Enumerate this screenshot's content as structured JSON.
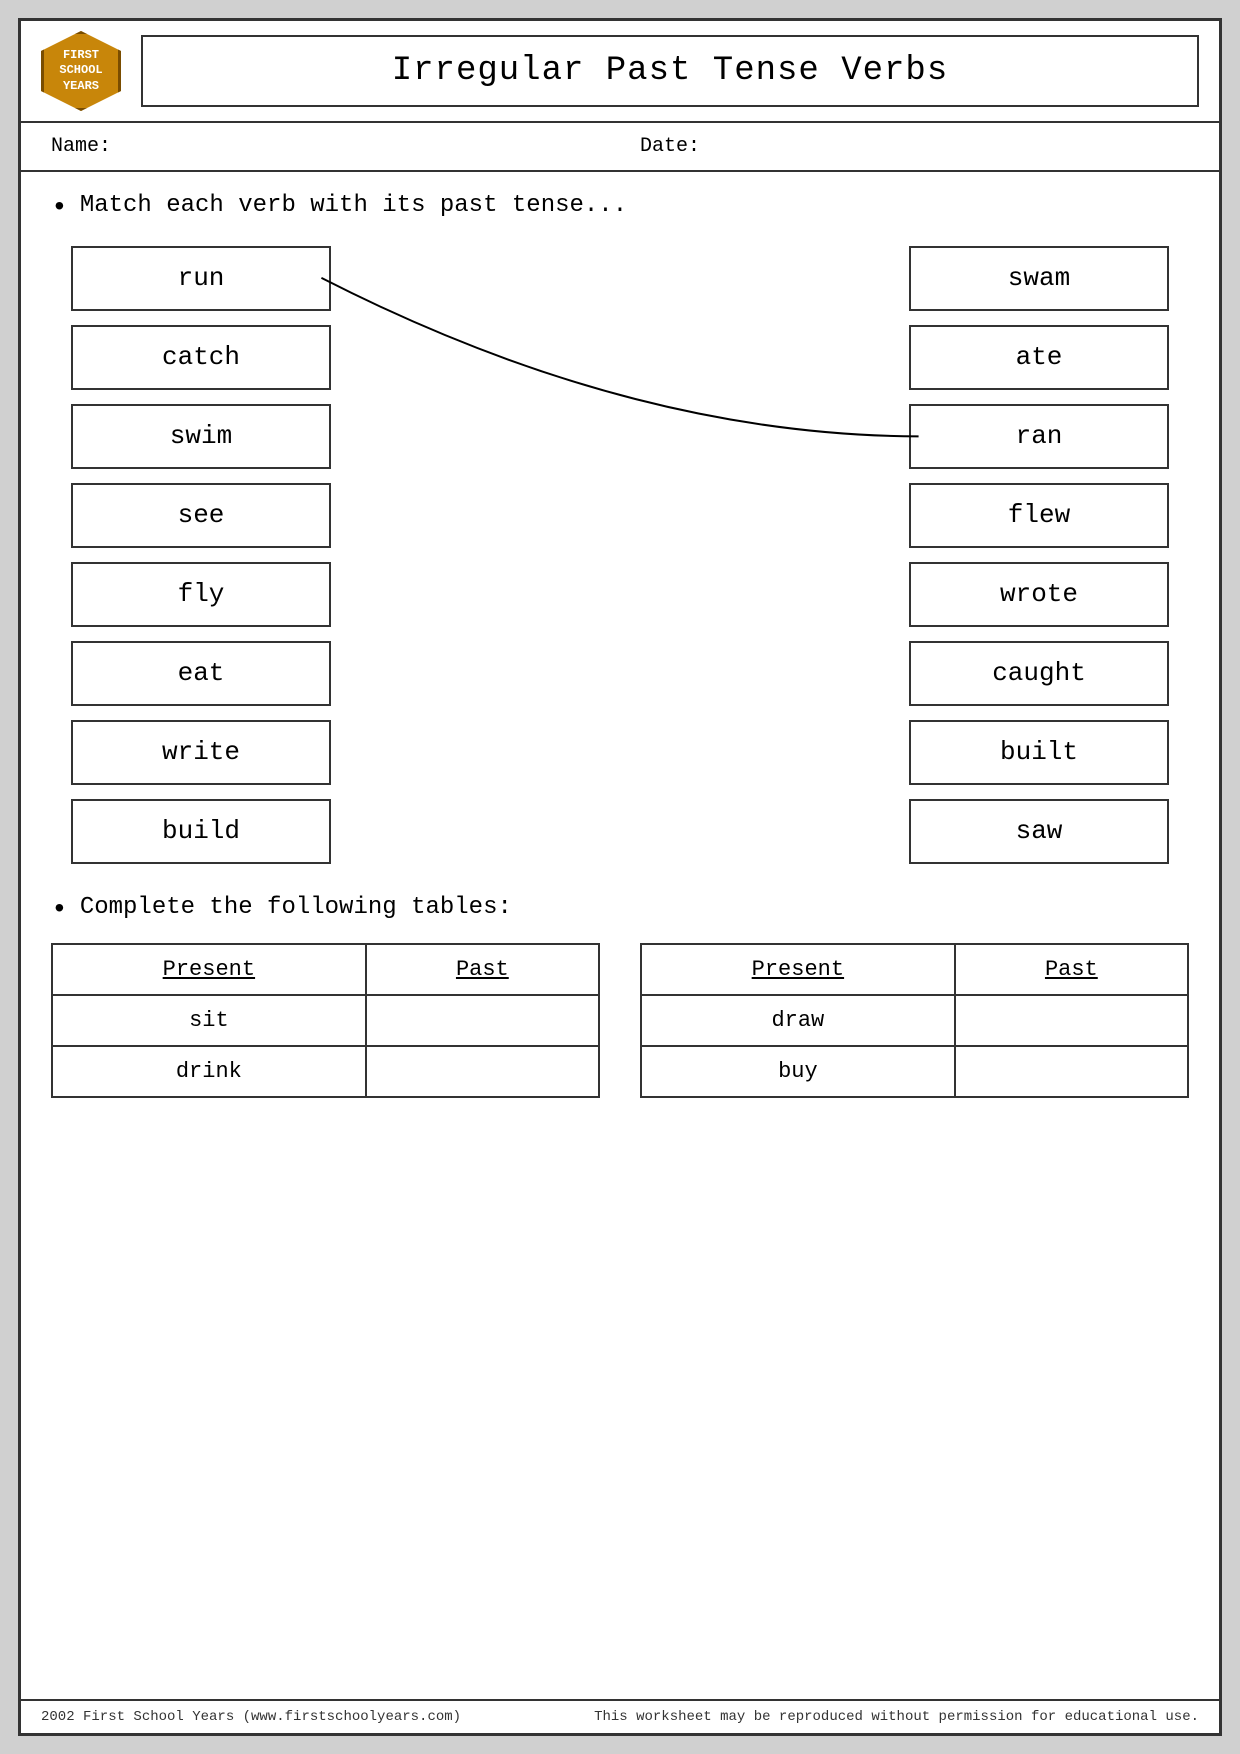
{
  "header": {
    "logo": {
      "line1": "FIRST",
      "line2": "SCHOOL",
      "line3": "YEARS"
    },
    "title": "Irregular Past Tense Verbs"
  },
  "form": {
    "name_label": "Name:",
    "date_label": "Date:"
  },
  "instructions": {
    "match_instruction": "Match each verb with its past tense...",
    "table_instruction": "Complete the following tables:"
  },
  "left_verbs": [
    "run",
    "catch",
    "swim",
    "see",
    "fly",
    "eat",
    "write",
    "build"
  ],
  "right_verbs": [
    "swam",
    "ate",
    "ran",
    "flew",
    "wrote",
    "caught",
    "built",
    "saw"
  ],
  "table1": {
    "col1_header": "Present",
    "col2_header": "Past",
    "rows": [
      {
        "present": "sit",
        "past": ""
      },
      {
        "present": "drink",
        "past": ""
      }
    ]
  },
  "table2": {
    "col1_header": "Present",
    "col2_header": "Past",
    "rows": [
      {
        "present": "draw",
        "past": ""
      },
      {
        "present": "buy",
        "past": ""
      }
    ]
  },
  "footer": {
    "left": "2002 First School Years  (www.firstschoolyears.com)",
    "right": "This worksheet may be reproduced without permission for educational use."
  }
}
